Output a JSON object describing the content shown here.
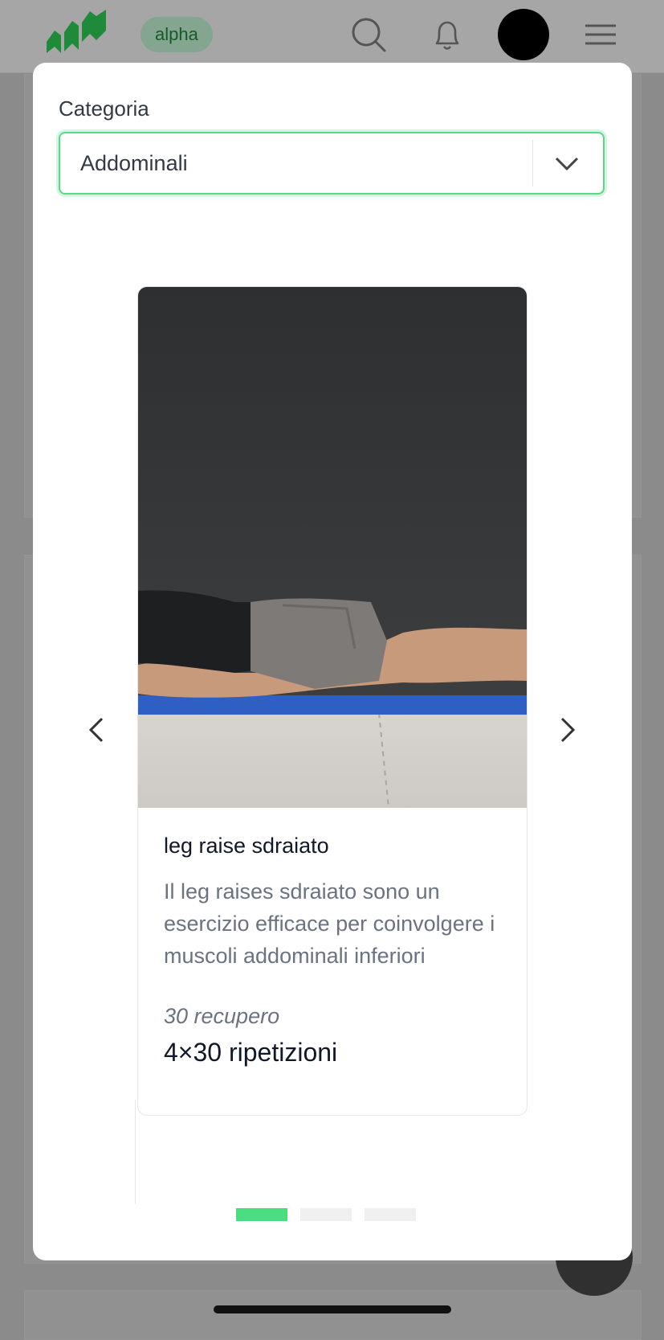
{
  "header": {
    "logo_icon": "brand-logo-icon",
    "badge": "alpha",
    "icons": [
      "search-icon",
      "bell-icon",
      "avatar",
      "menu-icon"
    ]
  },
  "modal": {
    "category_label": "Categoria",
    "category_value": "Addominali",
    "card": {
      "title": "leg raise sdraiato",
      "description": "Il leg raises sdraiato sono un esercizio efficace per coinvolgere i muscoli addominali inferiori",
      "rest": "30 recupero",
      "reps": "4×30 ripetizioni"
    },
    "carousel": {
      "slide_count": 3,
      "active_index": 0
    }
  },
  "colors": {
    "accent": "#4ade80",
    "brand": "#1f8a3a",
    "overlay": "#8b8b8b"
  }
}
